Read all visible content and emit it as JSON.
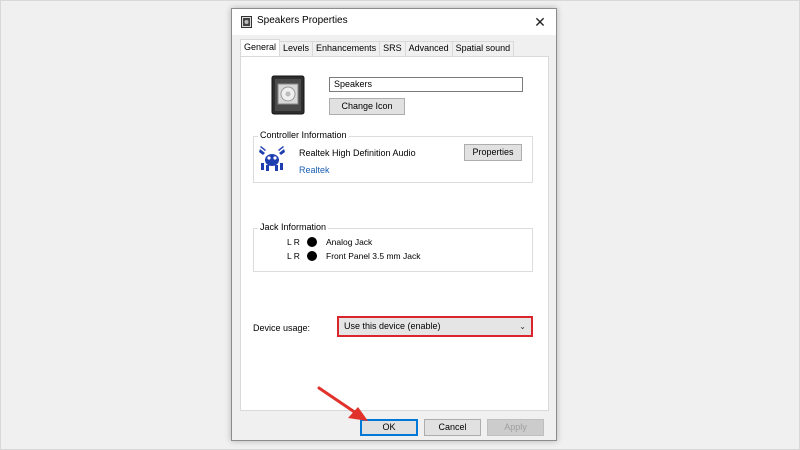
{
  "window": {
    "title": "Speakers Properties",
    "close_glyph": "✕"
  },
  "tabs": [
    {
      "label": "General",
      "active": true
    },
    {
      "label": "Levels"
    },
    {
      "label": "Enhancements"
    },
    {
      "label": "SRS"
    },
    {
      "label": "Advanced"
    },
    {
      "label": "Spatial sound"
    }
  ],
  "general": {
    "device_name": "Speakers",
    "change_icon_label": "Change Icon"
  },
  "controller": {
    "group_label": "Controller Information",
    "name": "Realtek High Definition Audio",
    "vendor_link": "Realtek",
    "properties_label": "Properties"
  },
  "jack": {
    "group_label": "Jack Information",
    "rows": [
      {
        "channels": "L R",
        "name": "Analog Jack"
      },
      {
        "channels": "L R",
        "name": "Front Panel 3.5 mm Jack"
      }
    ]
  },
  "device_usage": {
    "label": "Device usage:",
    "selected": "Use this device (enable)"
  },
  "footer": {
    "ok_label": "OK",
    "cancel_label": "Cancel",
    "apply_label": "Apply"
  },
  "colors": {
    "highlight": "#d9252b",
    "arrow": "#e0312a",
    "link": "#1a5fb4",
    "focus": "#0078d7"
  }
}
